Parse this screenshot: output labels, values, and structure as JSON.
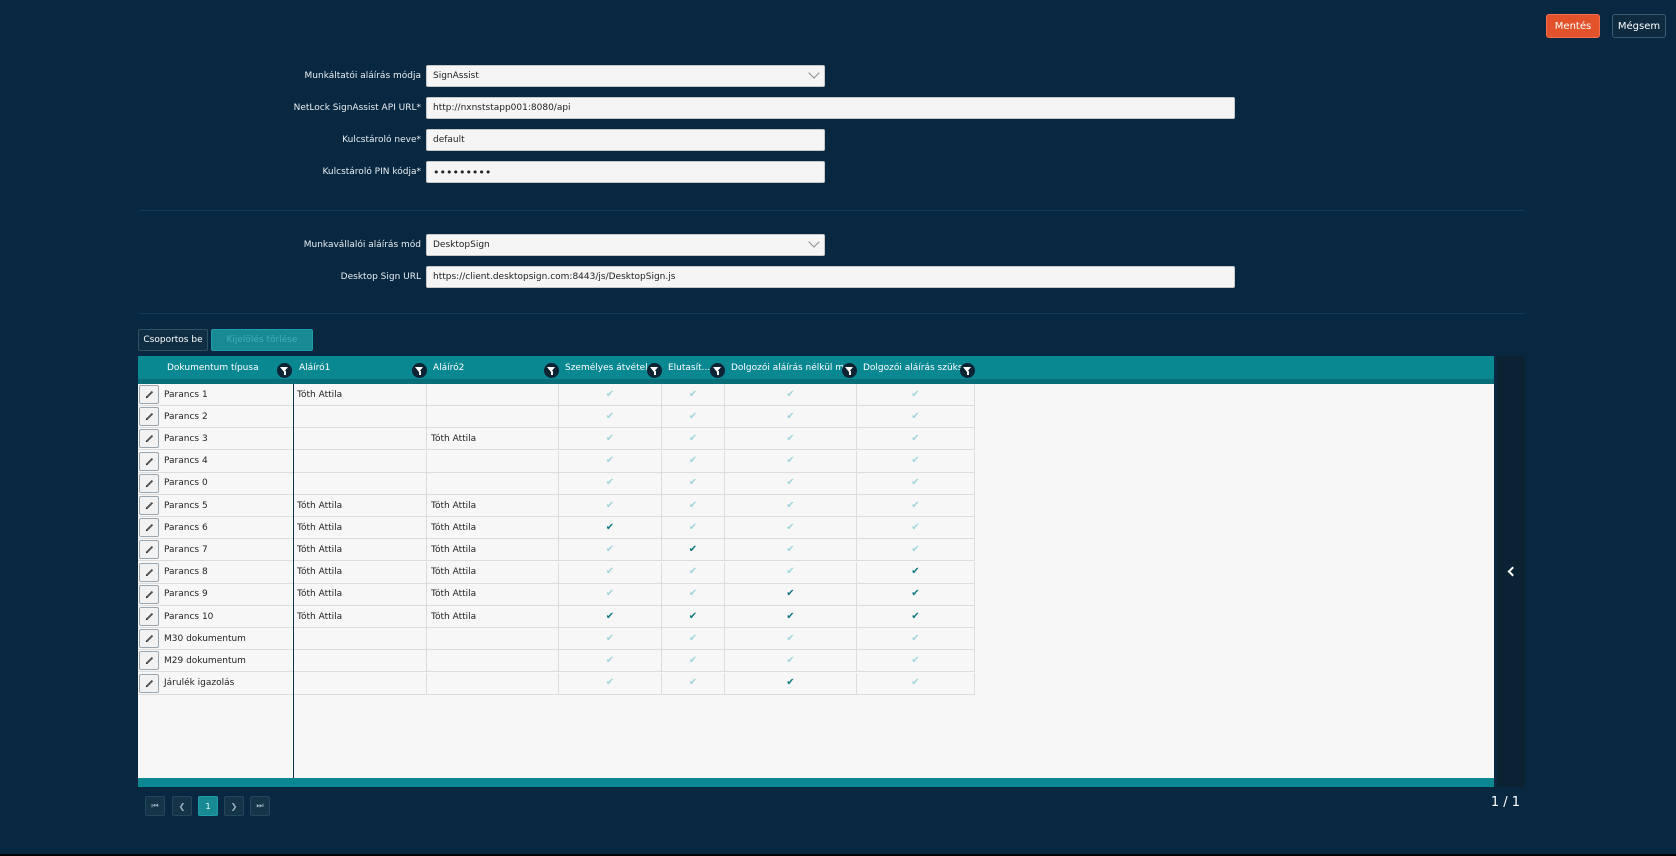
{
  "toolbar": {
    "save_label": "Mentés",
    "cancel_label": "Mégsem"
  },
  "employer": {
    "mode_label": "Munkáltatói aláírás módja",
    "mode_value": "SignAssist",
    "api_label": "NetLock SignAssist API URL*",
    "api_value": "http://nxnststapp001:8080/api",
    "keystore_label": "Kulcstároló neve*",
    "keystore_value": "default",
    "pin_label": "Kulcstároló PIN kódja*",
    "pin_value": "•••••••••"
  },
  "employee": {
    "mode_label": "Munkavállalói aláírás mód",
    "mode_value": "DesktopSign",
    "url_label": "Desktop Sign URL",
    "url_value": "https://client.desktopsign.com:8443/js/DesktopSign.js"
  },
  "table_actions": {
    "group_label": "Csoportos be",
    "clear_label": "Kijelölés törlése"
  },
  "grid": {
    "columns": [
      "Dokumentum típusa",
      "Aláíró1",
      "Aláíró2",
      "Személyes átvétel",
      "Elutasít...",
      "Dolgozói aláírás nélkül m...",
      "Dolgozói aláírás szüks..."
    ],
    "rows": [
      {
        "doc": "Parancs 1",
        "s1": "Tóth Attila",
        "s2": "",
        "c": [
          0,
          0,
          0,
          0
        ]
      },
      {
        "doc": "Parancs 2",
        "s1": "",
        "s2": "",
        "c": [
          0,
          0,
          0,
          0
        ]
      },
      {
        "doc": "Parancs 3",
        "s1": "",
        "s2": "Tóth Attila",
        "c": [
          0,
          0,
          0,
          0
        ]
      },
      {
        "doc": "Parancs 4",
        "s1": "",
        "s2": "",
        "c": [
          0,
          0,
          0,
          0
        ]
      },
      {
        "doc": "Parancs 0",
        "s1": "",
        "s2": "",
        "c": [
          0,
          0,
          0,
          0
        ]
      },
      {
        "doc": "Parancs 5",
        "s1": "Tóth Attila",
        "s2": "Tóth Attila",
        "c": [
          0,
          0,
          0,
          0
        ]
      },
      {
        "doc": "Parancs 6",
        "s1": "Tóth Attila",
        "s2": "Tóth Attila",
        "c": [
          1,
          0,
          0,
          0
        ]
      },
      {
        "doc": "Parancs 7",
        "s1": "Tóth Attila",
        "s2": "Tóth Attila",
        "c": [
          0,
          1,
          0,
          0
        ]
      },
      {
        "doc": "Parancs 8",
        "s1": "Tóth Attila",
        "s2": "Tóth Attila",
        "c": [
          0,
          0,
          0,
          1
        ]
      },
      {
        "doc": "Parancs 9",
        "s1": "Tóth Attila",
        "s2": "Tóth Attila",
        "c": [
          0,
          0,
          1,
          1
        ]
      },
      {
        "doc": "Parancs 10",
        "s1": "Tóth Attila",
        "s2": "Tóth Attila",
        "c": [
          1,
          1,
          1,
          1
        ]
      },
      {
        "doc": "M30 dokumentum",
        "s1": "",
        "s2": "",
        "c": [
          0,
          0,
          0,
          0
        ]
      },
      {
        "doc": "M29 dokumentum",
        "s1": "",
        "s2": "",
        "c": [
          0,
          0,
          0,
          0
        ]
      },
      {
        "doc": "Járulék igazolás",
        "s1": "",
        "s2": "",
        "c": [
          0,
          0,
          1,
          0
        ]
      }
    ]
  },
  "pagination": {
    "current": "1",
    "info": "1 / 1"
  },
  "colors": {
    "background": "#082841",
    "accent": "#0a8892",
    "save": "#e2532b"
  }
}
